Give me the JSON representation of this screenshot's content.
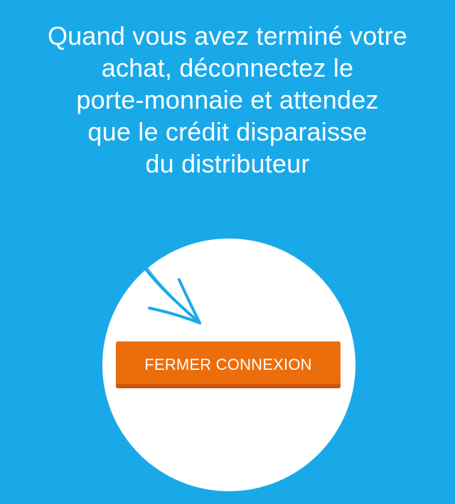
{
  "instruction": {
    "lines": [
      "Quand vous avez terminé votre",
      "achat, déconnectez le",
      "porte-monnaie et attendez",
      "que le crédit disparaisse",
      "du distributeur"
    ]
  },
  "button": {
    "label": "FERMER CONNEXION"
  },
  "icon": {
    "arrow": "curved-arrow-icon"
  },
  "colors": {
    "background": "#1aa9e8",
    "circle": "#ffffff",
    "button": "#ec6d0c",
    "button_shadow": "#c95608",
    "text": "#ffffff"
  }
}
